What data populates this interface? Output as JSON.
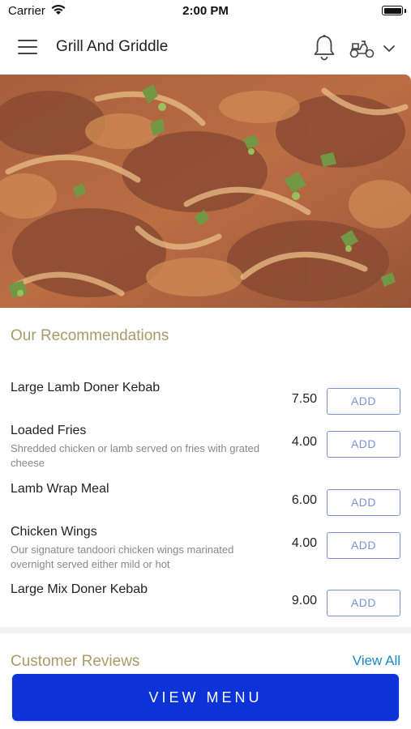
{
  "status_bar": {
    "carrier": "Carrier",
    "time": "2:00 PM"
  },
  "header": {
    "title": "Grill And Griddle",
    "icons": [
      "menu-icon",
      "bell-icon",
      "scooter-icon",
      "chevron-down-icon"
    ]
  },
  "recommendations": {
    "title": "Our Recommendations",
    "add_label": "ADD",
    "items": [
      {
        "name": "Large Lamb Doner Kebab",
        "description": "",
        "price": "7.50"
      },
      {
        "name": "Loaded Fries",
        "description": "Shredded chicken or lamb served on fries with grated cheese",
        "price": "4.00"
      },
      {
        "name": "Lamb Wrap Meal",
        "description": "",
        "price": "6.00"
      },
      {
        "name": "Chicken Wings",
        "description": "Our signature tandoori chicken wings marinated overnight served either mild or hot",
        "price": "4.00"
      },
      {
        "name": "Large Mix Doner Kebab",
        "description": "",
        "price": "9.00"
      }
    ]
  },
  "reviews": {
    "title": "Customer Reviews",
    "view_all": "View All"
  },
  "cta": {
    "label": "VIEW MENU",
    "color": "#0b33d8"
  },
  "colors": {
    "accent_gold": "#a99a6b",
    "add_blue": "#7b92d6",
    "link_blue": "#1a88c9"
  }
}
